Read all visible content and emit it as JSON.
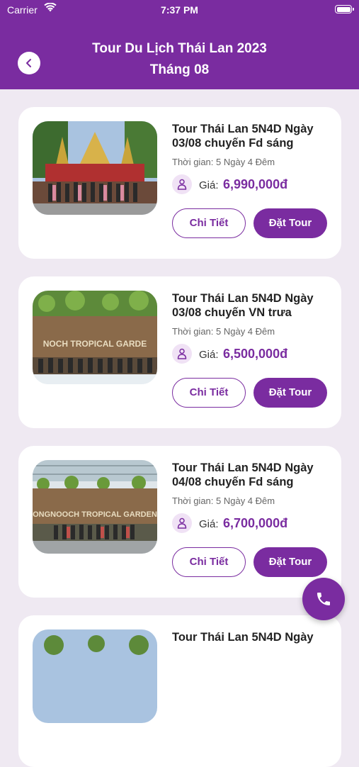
{
  "status_bar": {
    "carrier": "Carrier",
    "time": "7:37 PM"
  },
  "header": {
    "title_line1": "Tour Du Lịch Thái Lan 2023",
    "title_line2": "Tháng 08"
  },
  "tours": [
    {
      "title_line1": "Tour Thái Lan 5N4D Ngày",
      "title_line2": "03/08 chuyến Fd sáng",
      "duration": "Thời gian: 5 Ngày 4 Đêm",
      "price_label": "Giá:",
      "price": "6,990,000đ",
      "detail_label": "Chi Tiết",
      "book_label": "Đặt Tour"
    },
    {
      "title_line1": "Tour Thái Lan 5N4D Ngày",
      "title_line2": "03/08 chuyến VN trưa",
      "duration": "Thời gian: 5 Ngày 4 Đêm",
      "price_label": "Giá:",
      "price": "6,500,000đ",
      "detail_label": "Chi Tiết",
      "book_label": "Đặt Tour",
      "image_sign_text": "NOCH TROPICAL GARDE"
    },
    {
      "title_line1": "Tour Thái Lan 5N4D Ngày",
      "title_line2": "04/08 chuyến Fd sáng",
      "duration": "Thời gian: 5 Ngày 4 Đêm",
      "price_label": "Giá:",
      "price": "6,700,000đ",
      "detail_label": "Chi Tiết",
      "book_label": "Đặt Tour",
      "image_sign_text": "ONGNOOCH TROPICAL GARDEN"
    },
    {
      "title_line1": "Tour Thái Lan 5N4D Ngày"
    }
  ],
  "colors": {
    "primary": "#7a2ca0",
    "background": "#efe9f2",
    "price_icon_bg": "#f0e2f5"
  },
  "icons": {
    "back": "chevron-left-icon",
    "person": "person-icon",
    "phone": "phone-icon",
    "wifi": "wifi-icon",
    "battery": "battery-icon"
  }
}
